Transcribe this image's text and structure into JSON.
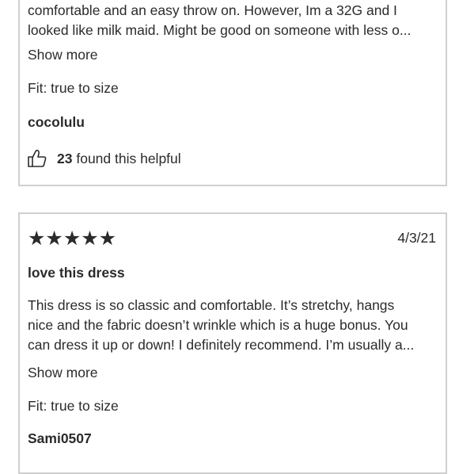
{
  "reviews": [
    {
      "body_lines": [
        "comfortable and an easy throw on. However, Im a 32G and I",
        "looked like milk maid. Might be good on someone with less o..."
      ],
      "show_more": "Show more",
      "fit": "Fit: true to size",
      "username": "cocolulu",
      "helpful_count": "23",
      "helpful_text": "found this helpful"
    },
    {
      "stars": "★★★★★",
      "rating": 5,
      "date": "4/3/21",
      "title": "love this dress",
      "body_lines": [
        "This dress is so classic and comfortable. It’s stretchy, hangs",
        "nice and the fabric doesn’t wrinkle which is a huge bonus. You",
        "can dress it up or down! I definitely recommend. I’m usually a..."
      ],
      "show_more": "Show more",
      "fit": "Fit: true to size",
      "username": "Sami0507"
    }
  ],
  "icons": {
    "helpful": "thumbs-up-icon",
    "rating": "star-icon"
  },
  "colors": {
    "text": "#2b2b2b",
    "border": "#cfcfcf",
    "background": "#ffffff"
  }
}
